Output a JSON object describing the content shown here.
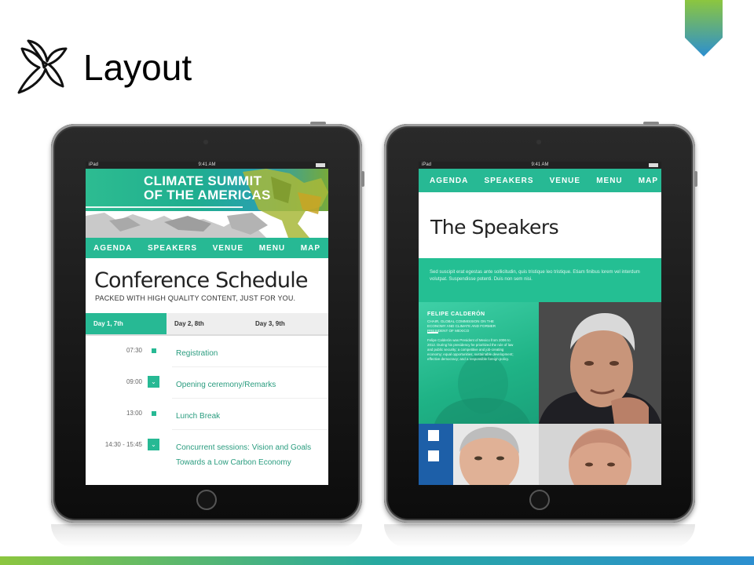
{
  "slide": {
    "title": "Layout",
    "colors": {
      "accent_green": "#27b994",
      "bar_start": "#8cc63f",
      "bar_end": "#2c8fd0"
    }
  },
  "left_tablet": {
    "status": {
      "carrier": "iPad",
      "time": "9:41 AM"
    },
    "banner": {
      "line1": "CLIMATE SUMMIT",
      "line2": "OF THE AMERICAS"
    },
    "nav": [
      "AGENDA",
      "SPEAKERS",
      "VENUE",
      "MENU",
      "MAP"
    ],
    "title": "Conference Schedule",
    "subtitle": "PACKED WITH HIGH QUALITY CONTENT, JUST FOR YOU.",
    "tabs": [
      "Day 1, 7th",
      "Day 2, 8th",
      "Day 3, 9th"
    ],
    "active_tab": "Day 1, 7th",
    "schedule": [
      {
        "time": "07:30",
        "title": "Registration",
        "marker": "dot"
      },
      {
        "time": "09:00",
        "title": "Opening ceremony/Remarks",
        "marker": "chevron"
      },
      {
        "time": "13:00",
        "title": "Lunch Break",
        "marker": "dot"
      },
      {
        "time": "14:30 - 15:45",
        "title": "Concurrent sessions: Vision and Goals",
        "title2": "Towards a Low Carbon Economy",
        "marker": "chevron"
      }
    ]
  },
  "right_tablet": {
    "status": {
      "carrier": "iPad",
      "time": "9:41 AM"
    },
    "nav": [
      "AGENDA",
      "SPEAKERS",
      "VENUE",
      "MENU",
      "MAP"
    ],
    "title": "The Speakers",
    "intro": "Sed suscipit erat egestas ante sollicitudin, quis tristique leo tristique. Etiam finibus lorem vel interdum volutpat. Suspendisse potenti. Duis non sem nisi.",
    "featured": {
      "name": "FELIPE CALDERÓN",
      "role": "CHAIR, GLOBAL COMMISSION ON THE ECONOMY AND CLIMATE AND FORMER PRESIDENT OF MEXICO",
      "bio": "Felipe Calderón was President of Mexico from 2006 to 2012. During his presidency he prioritized the rule of law and public security; a competitive and job-creating economy; equal opportunities; sustainable development; effective democracy; and a responsible foreign policy."
    }
  }
}
